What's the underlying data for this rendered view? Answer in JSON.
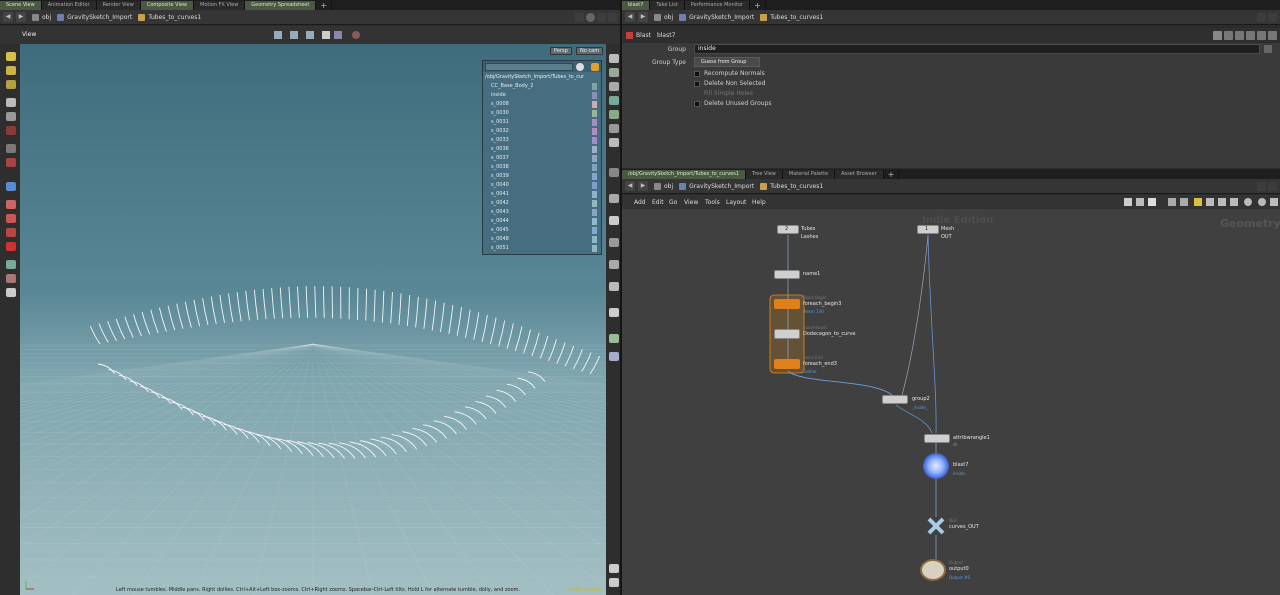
{
  "left_tabs": [
    "Scene View",
    "Animation Editor",
    "Render View",
    "Composite View",
    "Motion FX View",
    "Geometry Spreadsheet"
  ],
  "right_top_tabs": [
    "blast7",
    "Take List",
    "Performance Monitor"
  ],
  "network_tabs": [
    "/obj/GravitySketch_Import/Tubes_to_curves1",
    "Tree View",
    "Material Palette",
    "Asset Browser"
  ],
  "path": {
    "obj": "obj",
    "import": "GravitySketch_Import",
    "node": "Tubes_to_curves1"
  },
  "viewport": {
    "title": "View",
    "persp_label": "Persp",
    "cam_label": "No cam",
    "status_message": "Left mouse tumbles. Middle pans. Right dollies. Ctrl+Alt+Left box-zooms. Ctrl+Right zooms. Spacebar-Ctrl-Left tilts. Hold L for alternate tumble, dolly, and zoom.",
    "status_right": "Indie Edition"
  },
  "group_list": {
    "path": "/obj/GravitySketch_Import/Tubes_to_cur",
    "items": [
      "CC_Base_Body_2",
      "inside",
      "s_0008",
      "s_0030",
      "s_0031",
      "s_0032",
      "s_0033",
      "s_0036",
      "s_0037",
      "s_0038",
      "s_0039",
      "s_0040",
      "s_0041",
      "s_0042",
      "s_0043",
      "s_0044",
      "s_0045",
      "s_0048",
      "s_0051"
    ],
    "colors": [
      "#7ea6a6",
      "#8a8fb8",
      "#c9b0b0",
      "#96b4a0",
      "#a98dc0",
      "#b08fc0",
      "#9f8ec8",
      "#9db0c8",
      "#8ca7c4",
      "#7fa6b8",
      "#89a2cc",
      "#7e9fcd",
      "#8db3c9",
      "#94b8c2",
      "#8aa4c6",
      "#90b8d0",
      "#7eaccc",
      "#8db6c8",
      "#8fb8c0"
    ]
  },
  "parm": {
    "node_type": "Blast",
    "node_name": "blast7",
    "group_label": "Group",
    "group_value": "inside",
    "group_type_label": "Group Type",
    "group_type_value": "Guess from Group",
    "checkboxes": [
      "Recompute Normals",
      "Delete Non Selected",
      "Fill Simple Holes",
      "Delete Unused Groups"
    ]
  },
  "network": {
    "menu": [
      "Add",
      "Edit",
      "Go",
      "View",
      "Tools",
      "Layout",
      "Help"
    ],
    "watermark_left": "Indie Edition",
    "watermark_right": "Geometry",
    "nodes": {
      "tubes_count": "2",
      "tubes_name": "Tubes",
      "tubes_name2": "Lashes",
      "mesh_count": "1",
      "mesh_name": "Mesh",
      "mesh_name2": "OUT",
      "name1": "name1",
      "foreach_begin_type": "Block Begin",
      "foreach_begin": "foreach_begin3",
      "foreach_begin_sub": "Piece: 140",
      "dodecagon_type": "Subnetwork",
      "dodecagon": "Dodecagon_to_curve",
      "foreach_end_type": "Block End",
      "foreach_end": "foreach_end3",
      "foreach_end_sub": "Gather",
      "group2": "group2",
      "group2_sub": "_inside_",
      "wrangle": "attribwrangle1",
      "wrangle_sub": "dt",
      "blast": "blast7",
      "blast_sub": "inside",
      "null_type": "Null",
      "null_name": "curves_OUT",
      "output_type": "Output",
      "output_name": "output0",
      "output_sub": "Output #0"
    }
  }
}
